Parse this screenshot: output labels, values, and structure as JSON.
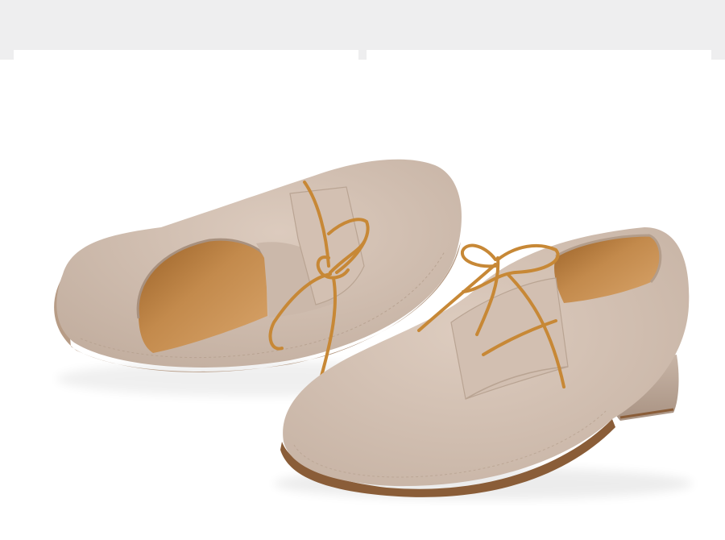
{
  "caption": {
    "lines": [
      "",
      "",
      ""
    ]
  },
  "colors": {
    "top_band": "#eeeeef",
    "background": "#ffffff",
    "suede": "#d6c3b5",
    "suede_shadow": "#b8a292",
    "lining": "#c98f4e",
    "lining_dark": "#8e5a25",
    "lace": "#c78836",
    "sole": "#8a5d38"
  },
  "scene": {
    "subject": "pair-of-tan-suede-lace-up-dance-shoes",
    "icons": [
      "shoe-left-icon",
      "shoe-right-icon"
    ]
  }
}
